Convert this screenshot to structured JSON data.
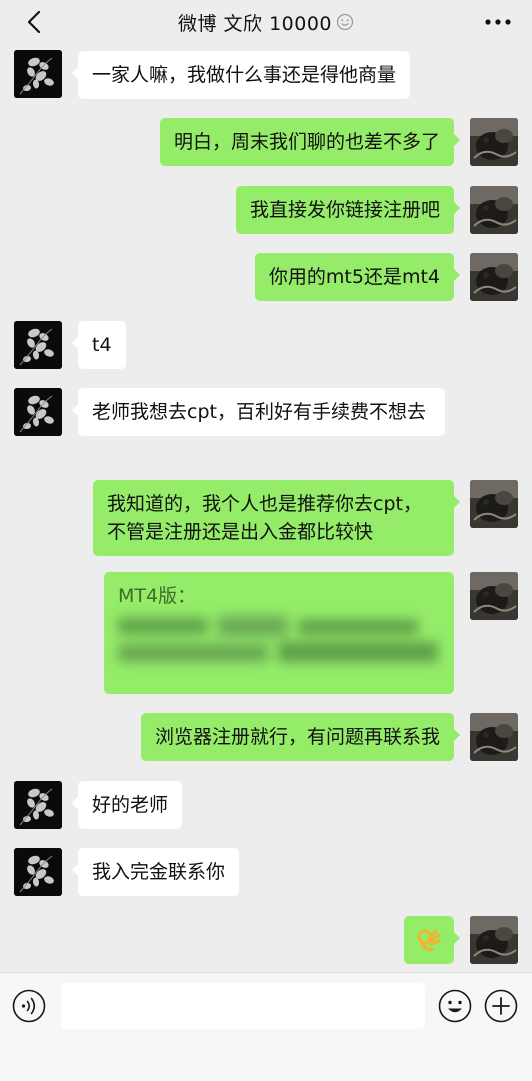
{
  "header": {
    "title": "微博 文欣 10000",
    "icons": {
      "back": "chevron-left-icon",
      "smile": "smile-icon",
      "more": "more-dots-icon"
    }
  },
  "messages": [
    {
      "side": "in",
      "text": "一家人嘛，我做什么事还是得他商量"
    },
    {
      "side": "out",
      "text": "明白，周末我们聊的也差不多了"
    },
    {
      "side": "out",
      "text": "我直接发你链接注册吧"
    },
    {
      "side": "out",
      "text": "你用的mt5还是mt4"
    },
    {
      "side": "in",
      "text": "t4"
    },
    {
      "side": "in",
      "text": "老师我想去cpt，百利好有手续费不想去"
    },
    {
      "side": "out",
      "text": "我知道的，我个人也是推荐你去cpt，不管是注册还是出入金都比较快"
    },
    {
      "side": "out",
      "text": "MT4版：",
      "redacted": true
    },
    {
      "side": "out",
      "text": "浏览器注册就行，有问题再联系我"
    },
    {
      "side": "in",
      "text": "好的老师"
    },
    {
      "side": "in",
      "text": "我入完金联系你"
    },
    {
      "side": "out",
      "emoji": "ok-hand-emoji"
    }
  ],
  "colors": {
    "background": "#ededed",
    "outgoing_bubble": "#95ec69",
    "incoming_bubble": "#ffffff",
    "bottom_bar": "#f7f7f7"
  },
  "input_bar": {
    "icons": {
      "voice": "voice-icon",
      "emoji": "emoji-icon",
      "plus": "plus-icon"
    }
  }
}
